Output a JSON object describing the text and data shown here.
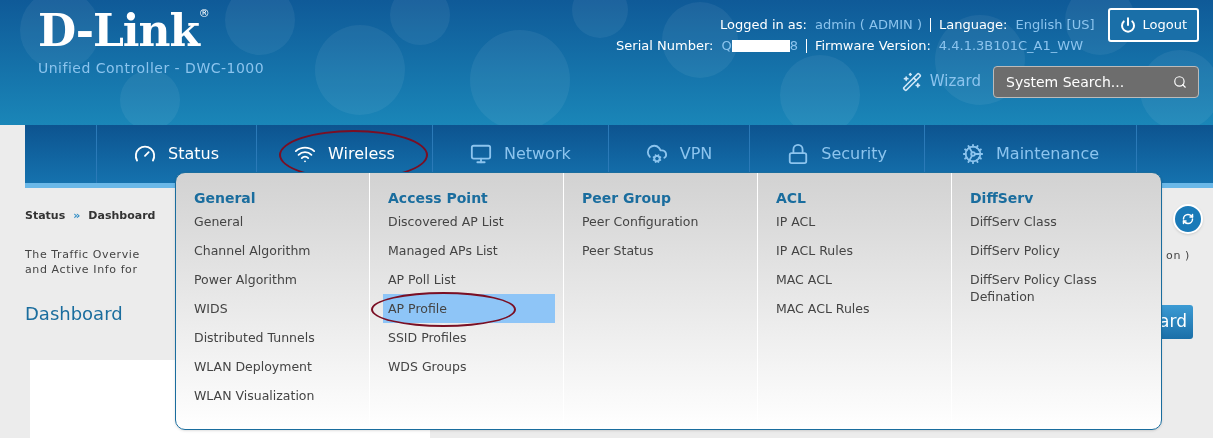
{
  "header": {
    "logo": "D-Link",
    "registered": "®",
    "subtitle": "Unified Controller - DWC-1000",
    "logged_in_label": "Logged in as:",
    "user": "admin ( ADMIN )",
    "language_label": "Language:",
    "language": "English [US]",
    "logout": "Logout",
    "serial_label": "Serial Number:",
    "serial_start": "Q",
    "serial_end": "8",
    "firmware_label": "Firmware Version:",
    "firmware": "4.4.1.3B101C_A1_WW",
    "wizard": "Wizard",
    "search_placeholder": "System Search..."
  },
  "nav": [
    {
      "label": "Status",
      "kind": "gauge",
      "selected": true,
      "circled": false
    },
    {
      "label": "Wireless",
      "kind": "wifi",
      "selected": true,
      "circled": true
    },
    {
      "label": "Network",
      "kind": "monitor",
      "selected": false,
      "circled": false
    },
    {
      "label": "VPN",
      "kind": "cloud",
      "selected": false,
      "circled": false
    },
    {
      "label": "Security",
      "kind": "lock",
      "selected": false,
      "circled": false
    },
    {
      "label": "Maintenance",
      "kind": "gears",
      "selected": false,
      "circled": false
    }
  ],
  "menu": [
    {
      "heading": "General",
      "items": [
        {
          "label": "General",
          "selected": false,
          "circled": false
        },
        {
          "label": "Channel Algorithm",
          "selected": false,
          "circled": false
        },
        {
          "label": "Power Algorithm",
          "selected": false,
          "circled": false
        },
        {
          "label": "WIDS",
          "selected": false,
          "circled": false
        },
        {
          "label": "Distributed Tunnels",
          "selected": false,
          "circled": false
        },
        {
          "label": "WLAN Deployment",
          "selected": false,
          "circled": false
        },
        {
          "label": "WLAN Visualization",
          "selected": false,
          "circled": false
        }
      ]
    },
    {
      "heading": "Access Point",
      "items": [
        {
          "label": "Discovered AP List",
          "selected": false,
          "circled": false
        },
        {
          "label": "Managed APs List",
          "selected": false,
          "circled": false
        },
        {
          "label": "AP Poll List",
          "selected": false,
          "circled": false
        },
        {
          "label": "AP Profile",
          "selected": true,
          "circled": true
        },
        {
          "label": "SSID Profiles",
          "selected": false,
          "circled": false
        },
        {
          "label": "WDS Groups",
          "selected": false,
          "circled": false
        }
      ]
    },
    {
      "heading": "Peer Group",
      "items": [
        {
          "label": "Peer Configuration",
          "selected": false,
          "circled": false
        },
        {
          "label": "Peer Status",
          "selected": false,
          "circled": false
        }
      ]
    },
    {
      "heading": "ACL",
      "items": [
        {
          "label": "IP ACL",
          "selected": false,
          "circled": false
        },
        {
          "label": "IP ACL Rules",
          "selected": false,
          "circled": false
        },
        {
          "label": "MAC ACL",
          "selected": false,
          "circled": false
        },
        {
          "label": "MAC ACL Rules",
          "selected": false,
          "circled": false
        }
      ]
    },
    {
      "heading": "DiffServ",
      "items": [
        {
          "label": "DiffServ Class",
          "selected": false,
          "circled": false
        },
        {
          "label": "DiffServ Policy",
          "selected": false,
          "circled": false
        },
        {
          "label": "DiffServ Policy Class Defination",
          "selected": false,
          "circled": false
        }
      ]
    }
  ],
  "page": {
    "breadcrumb": [
      "Status",
      "Dashboard"
    ],
    "separator": "»",
    "description": [
      "The Traffic Overvie",
      "and Active Info for"
    ],
    "description_end": "on )",
    "heading": "Dashboard",
    "button": "ard"
  }
}
